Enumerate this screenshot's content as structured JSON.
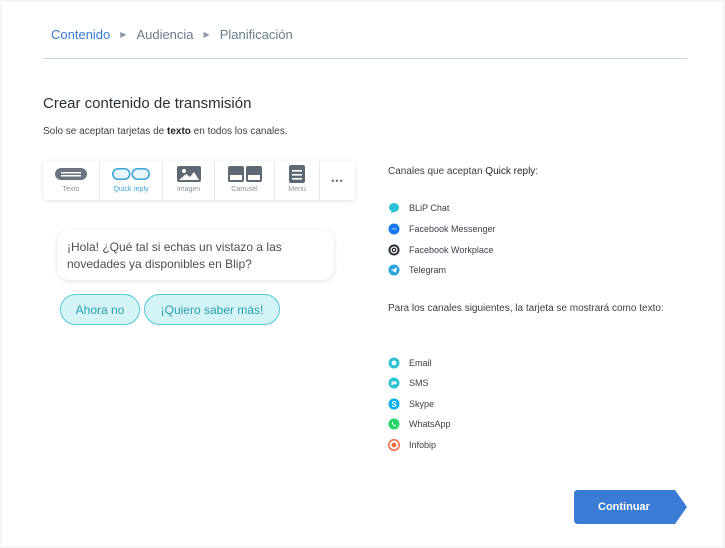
{
  "breadcrumb": {
    "steps": [
      "Contenido",
      "Audiencia",
      "Planificación"
    ]
  },
  "header": {
    "title": "Crear contenido de transmisión",
    "subtitle_before": "Solo se aceptan tarjetas de ",
    "subtitle_bold": "texto",
    "subtitle_after": " en todos los canales."
  },
  "toolbar": {
    "items": [
      {
        "label": "Texto",
        "icon": "text-icon"
      },
      {
        "label": "Quick reply",
        "icon": "quick-reply-icon",
        "selected": true
      },
      {
        "label": "Imagen",
        "icon": "image-icon"
      },
      {
        "label": "Carrusel",
        "icon": "carousel-icon"
      },
      {
        "label": "Menú",
        "icon": "menu-icon"
      }
    ],
    "more": "•••"
  },
  "preview": {
    "message": "¡Hola! ¿Qué tal si echas un vistazo a las novedades ya disponibles en Blip?",
    "quick_replies": [
      "Ahora no",
      "¡Quiero saber más!"
    ]
  },
  "side": {
    "accept_heading_before": "Canales que aceptan ",
    "accept_heading_bold": "Quick reply",
    "accept_heading_after": ":",
    "accept_channels": [
      {
        "name": "BLiP Chat",
        "icon": "blip-chat-icon",
        "color": "#2cc3d5"
      },
      {
        "name": "Facebook Messenger",
        "icon": "messenger-icon",
        "color": "#1877f2"
      },
      {
        "name": "Facebook Workplace",
        "icon": "workplace-icon",
        "color": "#20252b"
      },
      {
        "name": "Telegram",
        "icon": "telegram-icon",
        "color": "#2aa3de"
      }
    ],
    "text_heading": "Para los canales siguientes, la tarjeta se mostrará como texto:",
    "text_channels": [
      {
        "name": "Email",
        "icon": "email-icon",
        "color": "#2cc3d5"
      },
      {
        "name": "SMS",
        "icon": "sms-icon",
        "color": "#2cc3d5"
      },
      {
        "name": "Skype",
        "icon": "skype-icon",
        "color": "#00aff0"
      },
      {
        "name": "WhatsApp",
        "icon": "whatsapp-icon",
        "color": "#25d366"
      },
      {
        "name": "Infobip",
        "icon": "infobip-icon",
        "color": "#f26b3a"
      }
    ]
  },
  "footer": {
    "continue_label": "Continuar",
    "accent": "#3a7bd5"
  }
}
